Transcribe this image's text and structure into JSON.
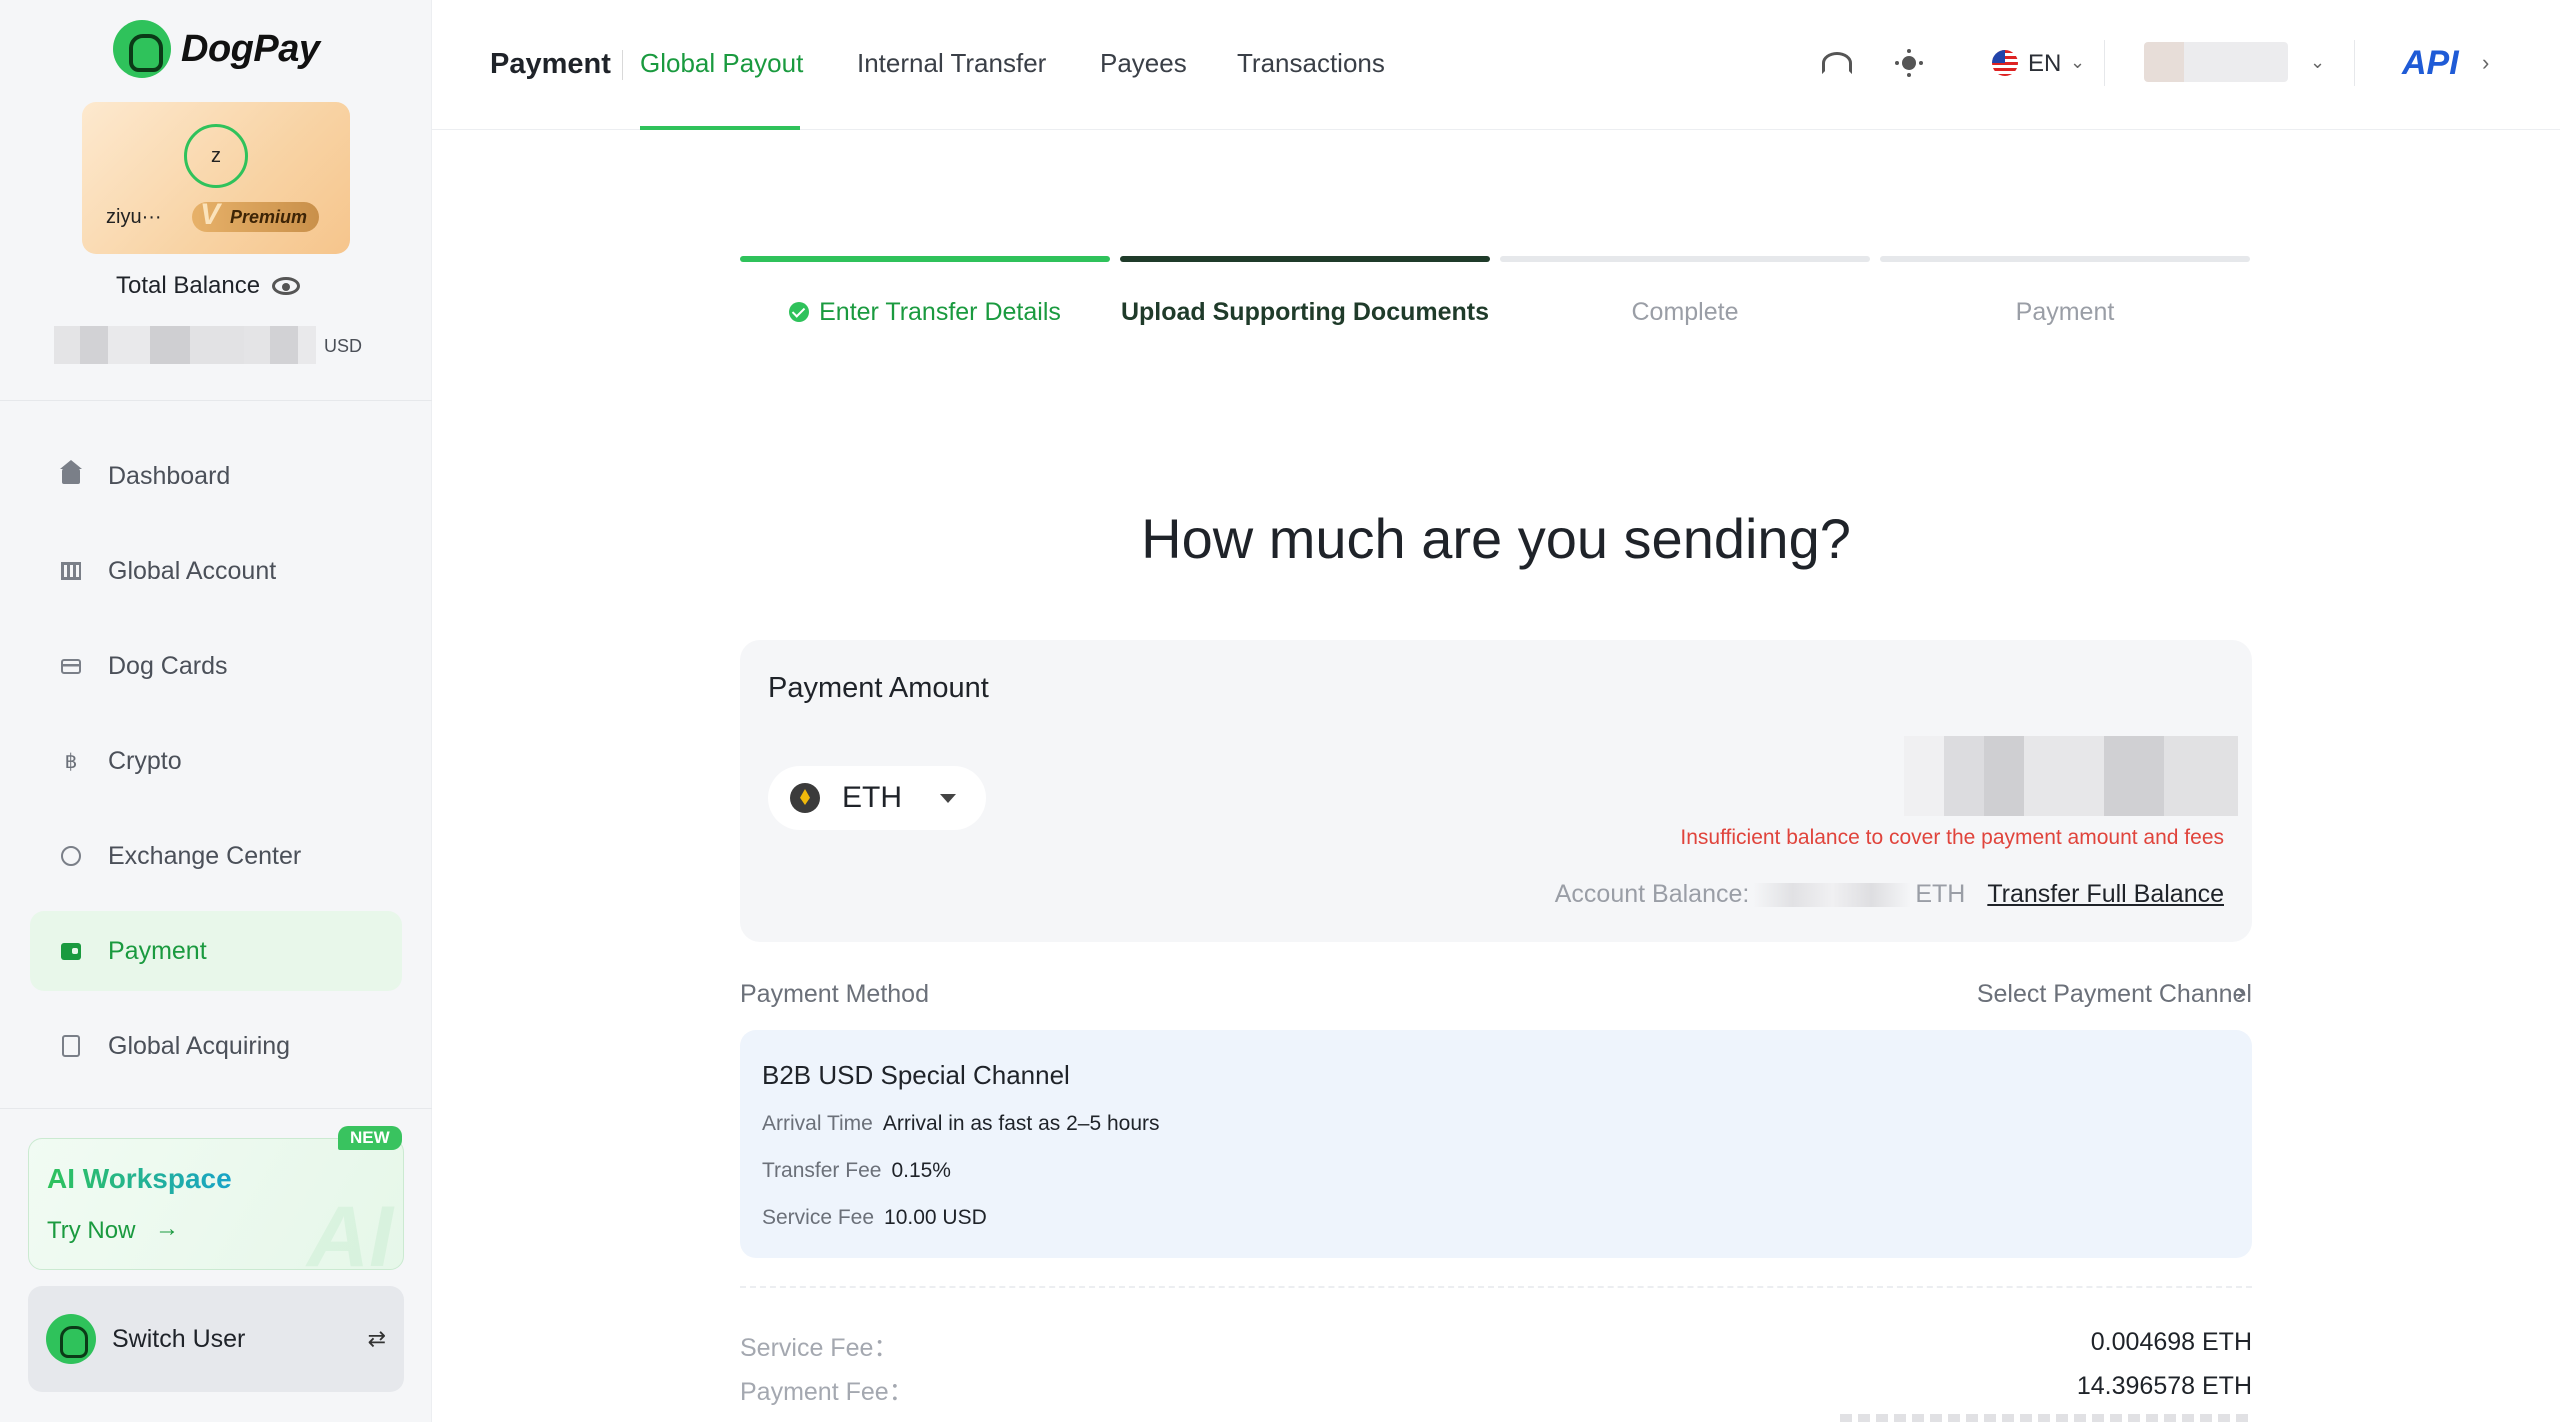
{
  "brand": {
    "name": "DogPay"
  },
  "profile": {
    "avatar_letter": "z",
    "name": "ziyu···",
    "tier": "Premium"
  },
  "balance": {
    "label": "Total Balance",
    "unit": "USD"
  },
  "sidebar": {
    "items": [
      {
        "label": "Dashboard",
        "icon": "home-icon"
      },
      {
        "label": "Global Account",
        "icon": "bank-icon"
      },
      {
        "label": "Dog Cards",
        "icon": "card-icon"
      },
      {
        "label": "Crypto",
        "icon": "bitcoin-icon"
      },
      {
        "label": "Exchange Center",
        "icon": "exchange-icon"
      },
      {
        "label": "Payment",
        "icon": "wallet-icon",
        "active": true
      },
      {
        "label": "Global Acquiring",
        "icon": "acquiring-icon"
      }
    ],
    "ai": {
      "title": "AI Workspace",
      "cta": "Try Now",
      "arrow": "→",
      "badge": "NEW",
      "bg": "AI"
    },
    "switch_user": {
      "label": "Switch User",
      "icon": "⇄"
    }
  },
  "topbar": {
    "section": "Payment",
    "tabs": [
      {
        "label": "Global Payout",
        "active": true
      },
      {
        "label": "Internal Transfer"
      },
      {
        "label": "Payees"
      },
      {
        "label": "Transactions"
      }
    ],
    "language": "EN",
    "api": "API",
    "chevron": "⌄",
    "chevron_right": "›"
  },
  "steps": [
    {
      "label": "Enter Transfer Details",
      "state": "done"
    },
    {
      "label": "Upload Supporting Documents",
      "state": "current"
    },
    {
      "label": "Complete",
      "state": "pending"
    },
    {
      "label": "Payment",
      "state": "pending"
    }
  ],
  "headline": "How much are you sending?",
  "amount": {
    "title": "Payment Amount",
    "currency": "ETH",
    "error": "Insufficient balance to cover the payment amount and fees",
    "account_balance_label": "Account Balance:",
    "account_balance_unit": "ETH",
    "transfer_full": "Transfer Full Balance"
  },
  "payment_method": {
    "label": "Payment Method",
    "select_label": "Select Payment Channel",
    "chevron": "›",
    "channel": {
      "title": "B2B USD Special Channel",
      "arrival_label": "Arrival Time",
      "arrival_value": "Arrival in as fast as 2–5 hours",
      "transfer_fee_label": "Transfer Fee",
      "transfer_fee_value": "0.15%",
      "service_fee_label": "Service Fee",
      "service_fee_value": "10.00 USD"
    }
  },
  "fees": [
    {
      "label": "Service Fee：",
      "value": "0.004698 ETH"
    },
    {
      "label": "Payment Fee：",
      "value": "14.396578 ETH"
    }
  ],
  "colors": {
    "accent": "#2fc25b",
    "accent_dark": "#1a9a3f",
    "error": "#e0443c",
    "api": "#1f5bd6"
  }
}
